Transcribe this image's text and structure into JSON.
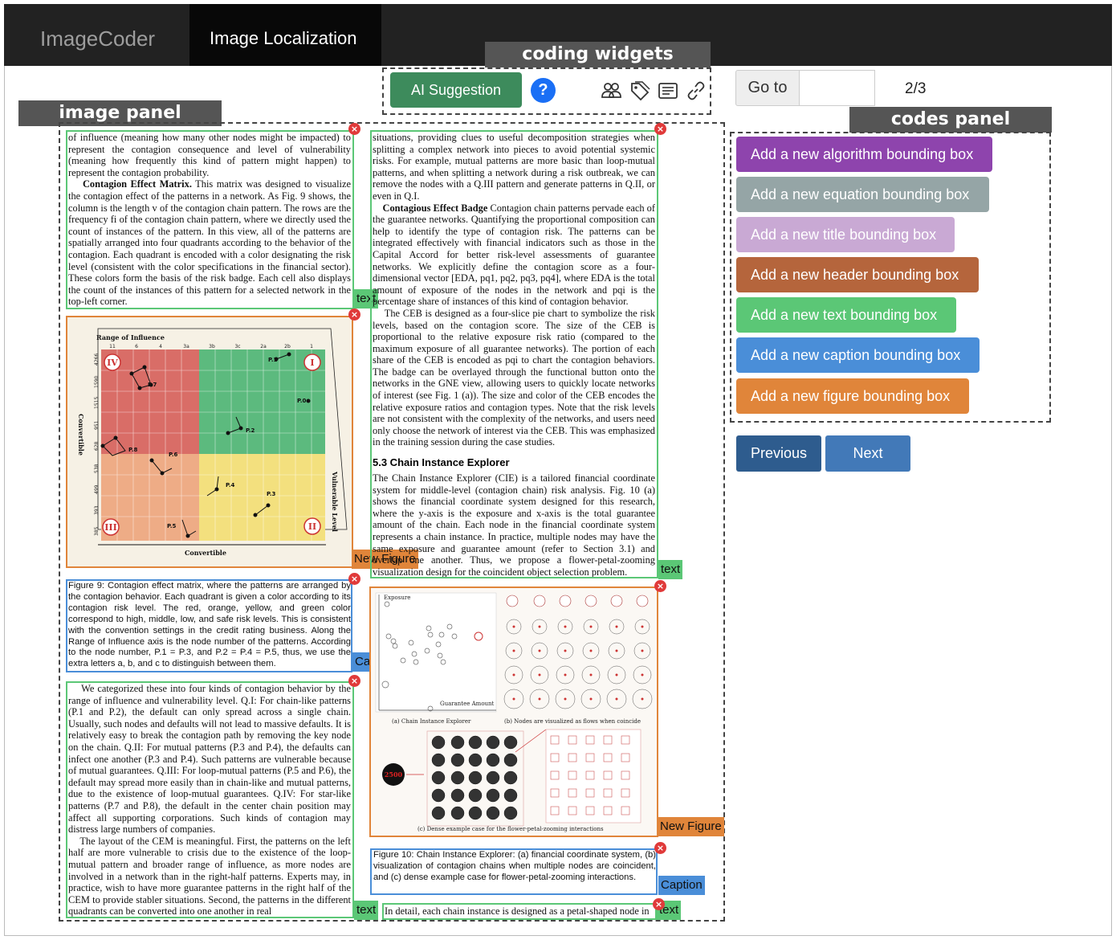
{
  "navbar": {
    "brand": "ImageCoder",
    "active_tab": "Image Localization"
  },
  "annotations": {
    "coding_widgets": "coding widgets",
    "image_panel": "image panel",
    "codes_panel": "codes panel"
  },
  "widgets": {
    "ai_suggestion_label": "AI Suggestion",
    "help_label": "?",
    "icons": [
      "people-icon",
      "tag-icon",
      "list-icon",
      "link-icon"
    ]
  },
  "goto": {
    "label": "Go to",
    "value": "",
    "page_indicator": "2/3"
  },
  "codes": [
    {
      "label": "Add a new algorithm bounding box",
      "color": "#8e44ad"
    },
    {
      "label": "Add a new equation bounding box",
      "color": "#95a5a6"
    },
    {
      "label": "Add a new title bounding box",
      "color": "#c9a9d4"
    },
    {
      "label": "Add a new header bounding box",
      "color": "#b5653c"
    },
    {
      "label": "Add a new text bounding box",
      "color": "#5bc776"
    },
    {
      "label": "Add a new caption bounding box",
      "color": "#4a8ed8"
    },
    {
      "label": "Add a new figure bounding box",
      "color": "#e0853a"
    }
  ],
  "pager": {
    "previous": "Previous",
    "next": "Next"
  },
  "box_tags": {
    "text": "text",
    "figure": "New Figure",
    "caption": "Caption",
    "close": "×"
  },
  "document": {
    "left_para1": "of influence (meaning how many other nodes might be impacted) to represent the contagion consequence and level of vulnerability (meaning how frequently this kind of pattern might happen) to represent the contagion probability.",
    "left_para2_head": "Contagion Effect Matrix.",
    "left_para2": " This matrix was designed to visualize the contagion effect of the patterns in a network. As Fig. 9 shows, the column is the length v of the contagion chain pattern. The rows are the frequency fi of the contagion chain pattern, where we directly used the count of instances of the pattern. In this view, all of the patterns are spatially arranged into four quadrants according to the behavior of the contagion. Each quadrant is encoded with a color designating the risk level (consistent with the color specifications in the financial sector). These colors form the basis of the risk badge. Each cell also displays the count of the instances of this pattern for a selected network in the top-left corner.",
    "fig9_caption": "Figure 9: Contagion effect matrix, where the patterns are arranged by the contagion behavior. Each quadrant is given a color according to its contagion risk level. The red, orange, yellow, and green color correspond to high, middle, low, and safe risk levels. This is consistent with the convention settings in the credit rating business. Along the Range of Influence axis is the node number of the patterns. According to the node number, P.1 = P.3, and P.2 = P.4 = P.5, thus, we use the extra letters a, b, and c to distinguish between them.",
    "left_para3": "We categorized these into four kinds of contagion behavior by the range of influence and vulnerability level. Q.I: For chain-like patterns (P.1 and P.2), the default can only spread across a single chain. Usually, such nodes and defaults will not lead to massive defaults. It is relatively easy to break the contagion path by removing the key node on the chain. Q.II: For mutual patterns (P.3 and P.4), the defaults can infect one another (P.3 and P.4). Such patterns are vulnerable because of mutual guarantees. Q.III: For loop-mutual patterns (P.5 and P.6), the default may spread more easily than in chain-like and mutual patterns, due to the existence of loop-mutual guarantees. Q.IV: For star-like patterns (P.7 and P.8), the default in the center chain position may affect all supporting corporations. Such kinds of contagion may distress large numbers of companies.",
    "left_para4": "The layout of the CEM is meaningful. First, the patterns on the left half are more vulnerable to crisis due to the existence of the loop-mutual pattern and broader range of influence, as more nodes are involved in a network than in the right-half patterns. Experts may, in practice, wish to have more guarantee patterns in the right half of the CEM to provide stabler situations. Second, the patterns in the different quadrants can be converted into one another in real",
    "right_para1": "situations, providing clues to useful decomposition strategies when splitting a complex network into pieces to avoid potential systemic risks. For example, mutual patterns are more basic than loop-mutual patterns, and when splitting a network during a risk outbreak, we can remove the nodes with a Q.III pattern and generate patterns in Q.II, or even in Q.I.",
    "right_para2_head": "Contagious Effect Badge",
    "right_para2": " Contagion chain patterns pervade each of the guarantee networks. Quantifying the proportional composition can help to identify the type of contagion risk. The patterns can be integrated effectively with financial indicators such as those in the Capital Accord for better risk-level assessments of guarantee networks. We explicitly define the contagion score as a four-dimensional vector [EDA, pq1, pq2, pq3, pq4], where EDA is the total amount of exposure of the nodes in the network and pqi is the percentage share of instances of this kind of contagion behavior.",
    "right_para3": "The CEB is designed as a four-slice pie chart to symbolize the risk levels, based on the contagion score. The size of the CEB is proportional to the relative exposure risk ratio (compared to the maximum exposure of all guarantee networks). The portion of each share of the CEB is encoded as pqi to chart the contagion behaviors. The badge can be overlayed through the functional button onto the networks in the GNE view, allowing users to quickly locate networks of interest (see Fig. 1 (a)). The size and color of the CEB encodes the relative exposure ratios and contagion types. Note that the risk levels are not consistent with the complexity of the networks, and users need only choose the network of interest via the CEB. This was emphasized in the training session during the case studies.",
    "section_heading": "5.3   Chain Instance Explorer",
    "right_para4": "The Chain Instance Explorer (CIE) is a tailored financial coordinate system for middle-level (contagion chain) risk analysis. Fig. 10 (a) shows the financial coordinate system designed for this research, where the y-axis is the exposure and x-axis is the total guarantee amount of the chain. Each node in the financial coordinate system represents a chain instance. In practice, multiple nodes may have the same exposure and guarantee amount (refer to Section 3.1) and overlap one another. Thus, we propose a flower-petal-zooming visualization design for the coincident object selection problem.",
    "fig10_caption": "Figure 10: Chain Instance Explorer: (a) financial coordinate system, (b) visualization of contagion chains when multiple nodes are coincident, and (c) dense example case for flower-petal-zooming interactions.",
    "right_last_line": "In detail, each chain instance is designed as a petal-shaped node in"
  },
  "fig9": {
    "top_axis_label": "Range of Influence",
    "top_ticks": [
      "11",
      "6",
      "4",
      "3a",
      "3b",
      "3c",
      "2a",
      "2b",
      "1"
    ],
    "left_axis_label": "Convertible",
    "left_ticks": [
      "4266",
      "1590",
      "1515",
      "951",
      "628",
      "538",
      "499",
      "393",
      "385"
    ],
    "bottom_axis_label": "Convertible",
    "right_axis_label": "Vulnerable Level",
    "quadrants": [
      "IV",
      "I",
      "III",
      "II"
    ],
    "patterns": [
      "P.1",
      "P.2",
      "P.3",
      "P.4",
      "P.5",
      "P.6",
      "P.7",
      "P.8",
      "P.0"
    ],
    "colors": {
      "red": "#d96d67",
      "green": "#5cba7e",
      "orange": "#eeac86",
      "yellow": "#f3e07e"
    }
  },
  "fig10": {
    "y_label": "Exposure",
    "x_label": "Guarantee Amount",
    "sub_a": "(a) Chain Instance Explorer",
    "sub_b": "(b) Nodes are visualized as flows when coincide",
    "sub_c": "(c) Dense example case for the flower-petal-zooming interactions",
    "badge": "2500"
  }
}
